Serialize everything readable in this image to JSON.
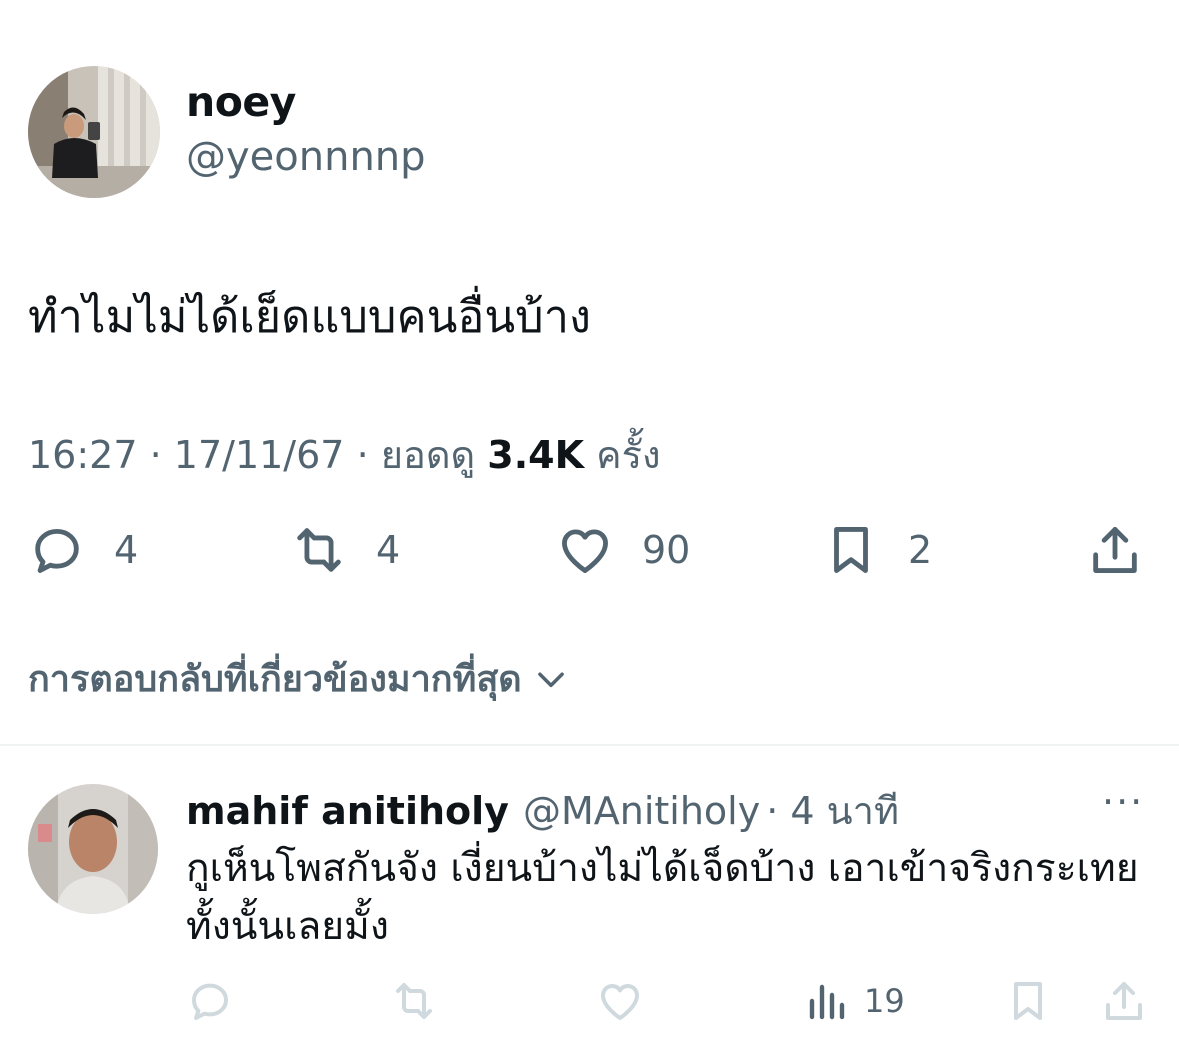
{
  "tweet": {
    "author_name": "noey",
    "author_handle": "@yeonnnnp",
    "text": "ทำไมไม่ได้เย็ดแบบคนอื่นบ้าง",
    "time": "16:27",
    "date": "17/11/67",
    "views_label": "ยอดดู",
    "views_count": "3.4K",
    "views_suffix": "ครั้ง",
    "separator": "·",
    "reply_count": "4",
    "retweet_count": "4",
    "like_count": "90",
    "bookmark_count": "2"
  },
  "sort": {
    "label": "การตอบกลับที่เกี่ยวข้องมากที่สุด"
  },
  "reply": {
    "author_name": "mahif anitiholy",
    "author_handle": "@MAnitiholy",
    "time_ago": "· 4 นาที",
    "more_label": "···",
    "text": "กูเห็นโพสกันจัง  เงี่ยนบ้างไม่ได้เจ็ดบ้าง เอาเข้าจริงกระเทย ทั้งนั้นเลยมั้ง",
    "views_count": "19"
  },
  "colors": {
    "text_primary": "#0f1419",
    "text_secondary": "#536471",
    "icon_muted": "#cfd9de",
    "divider": "#eff3f4"
  }
}
